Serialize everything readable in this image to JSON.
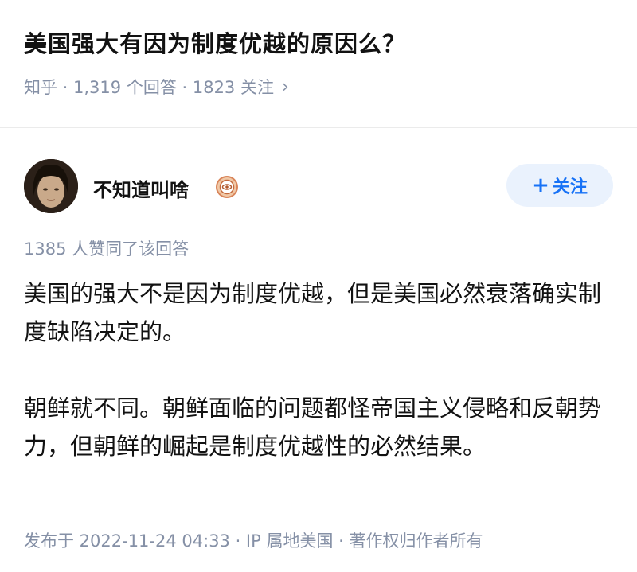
{
  "question": {
    "title": "美国强大有因为制度优越的原因么？",
    "meta": "知乎 · 1,319 个回答 · 1823 关注",
    "chevron": "›"
  },
  "author": {
    "name": "不知道叫啥",
    "follow_label": "关注",
    "follow_plus": "+"
  },
  "answer": {
    "vote_text": "1385 人赞同了该回答",
    "paragraph1": "美国的强大不是因为制度优越，但是美国必然衰落确实制度缺陷决定的。",
    "paragraph2": "朝鲜就不同。朝鲜面临的问题都怪帝国主义侵略和反朝势力，但朝鲜的崛起是制度优越性的必然结果。",
    "publish_meta": "发布于 2022-11-24 04:33 · IP 属地美国 · 著作权归作者所有"
  },
  "colors": {
    "accent": "#1772f6",
    "follow_bg": "#eaf2fd",
    "meta_gray": "#8590a6",
    "text": "#121212"
  },
  "icons": {
    "author_badge": "badge-icon",
    "meta_chevron": "chevron-right-icon"
  }
}
